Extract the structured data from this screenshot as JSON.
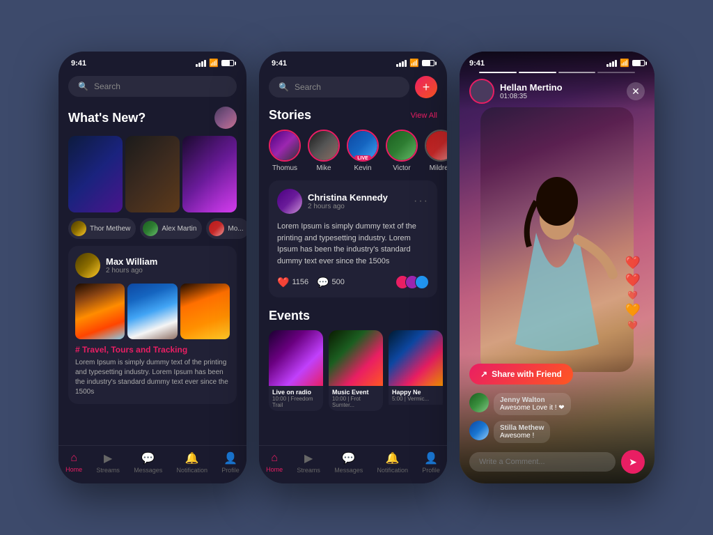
{
  "phone1": {
    "status": {
      "time": "9:41"
    },
    "search": {
      "placeholder": "Search"
    },
    "whats_new": "What's New?",
    "users": [
      "Thor Methew",
      "Alex Martin",
      "Mo..."
    ],
    "post": {
      "author": "Max William",
      "time": "2 hours ago",
      "tag": "# Travel, Tours and Tracking",
      "text": "Lorem Ipsum is simply dummy text of the printing and typesetting industry. Lorem Ipsum has been the industry's standard dummy text ever since the 1500s"
    },
    "nav": [
      "Home",
      "Streams",
      "Messages",
      "Notification",
      "Profile"
    ]
  },
  "phone2": {
    "status": {
      "time": "9:41"
    },
    "search": {
      "placeholder": "Search"
    },
    "stories_label": "Stories",
    "view_all": "View All",
    "stories": [
      {
        "name": "Thomus",
        "live": false
      },
      {
        "name": "Mike",
        "live": false
      },
      {
        "name": "Kevin",
        "live": true
      },
      {
        "name": "Victor",
        "live": false
      },
      {
        "name": "Mildred",
        "live": false
      }
    ],
    "post": {
      "author": "Christina Kennedy",
      "time": "2 hours ago",
      "text": "Lorem Ipsum is simply dummy text of the printing and typesetting industry. Lorem Ipsum has been the industry's standard dummy text ever since the 1500s",
      "likes": "1156",
      "comments": "500"
    },
    "events_label": "Events",
    "events": [
      {
        "title": "Live on radio",
        "time": "10:00 | Freedom Trail"
      },
      {
        "title": "Music Event",
        "time": "10:00 | Frot Sumter..."
      },
      {
        "title": "Happy Ne",
        "time": "5:00 | Vermic..."
      }
    ],
    "nav": [
      "Home",
      "Streams",
      "Messages",
      "Notification",
      "Profile"
    ]
  },
  "phone3": {
    "status": {
      "time": "9:41"
    },
    "user_name": "Hellan Mertino",
    "user_time": "01:08:35",
    "share_btn": "Share with Friend",
    "comments": [
      {
        "author": "Jenny Walton",
        "text": "Awesome Love it ! ❤"
      },
      {
        "author": "Stilla Methew",
        "text": "Awesome !"
      }
    ],
    "comment_placeholder": "Write a Comment..."
  }
}
